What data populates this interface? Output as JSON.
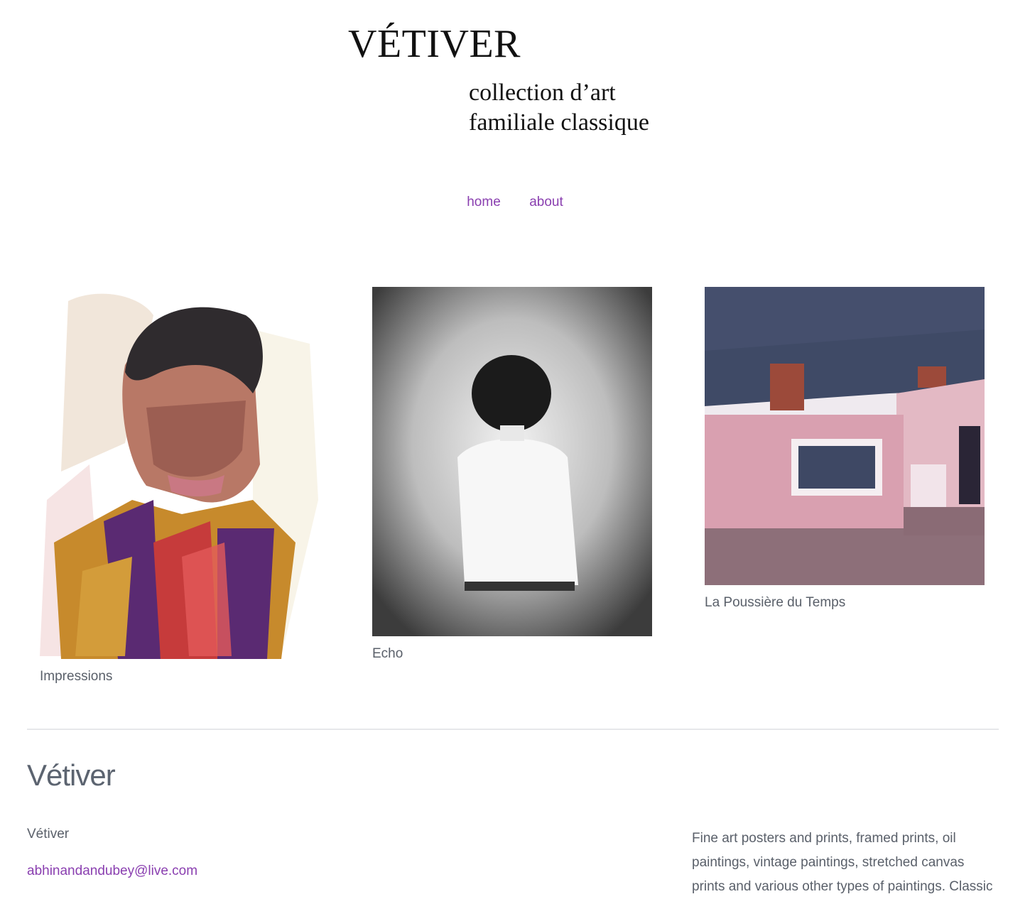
{
  "header": {
    "logo_title": "VÉTIVER",
    "logo_line1": "collection d’art",
    "logo_line2": "familiale classique"
  },
  "nav": {
    "items": [
      {
        "label": "home"
      },
      {
        "label": "about"
      }
    ]
  },
  "gallery": {
    "items": [
      {
        "caption": "Impressions"
      },
      {
        "caption": "Echo"
      },
      {
        "caption": "La Poussière du Temps"
      }
    ]
  },
  "footer": {
    "title": "Vétiver",
    "name": "Vétiver",
    "email": "abhinandandubey@live.com",
    "description": "Fine art posters and prints, framed prints, oil paintings, vintage paintings, stretched canvas prints and various other types of paintings. Classic"
  },
  "colors": {
    "link": "#8a3fb0",
    "text": "#5a606a",
    "heading": "#5c6470"
  }
}
